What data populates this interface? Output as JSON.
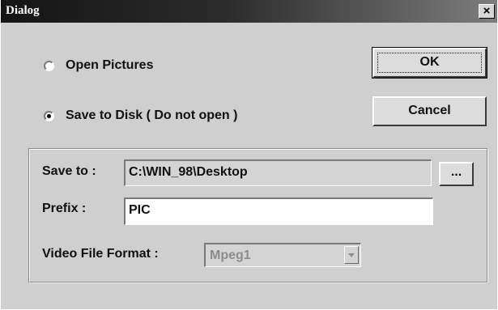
{
  "window": {
    "title": "Dialog",
    "close_glyph": "×"
  },
  "options": {
    "open_pictures": "Open Pictures",
    "save_to_disk": "Save to Disk ( Do not open )",
    "selected": "save_to_disk"
  },
  "buttons": {
    "ok": "OK",
    "cancel": "Cancel",
    "browse": "..."
  },
  "form": {
    "save_to_label": "Save to :",
    "save_to_value": "C:\\WIN_98\\Desktop",
    "prefix_label": "Prefix :",
    "prefix_value": "PIC",
    "format_label": "Video File Format :",
    "format_value": "Mpeg1"
  }
}
